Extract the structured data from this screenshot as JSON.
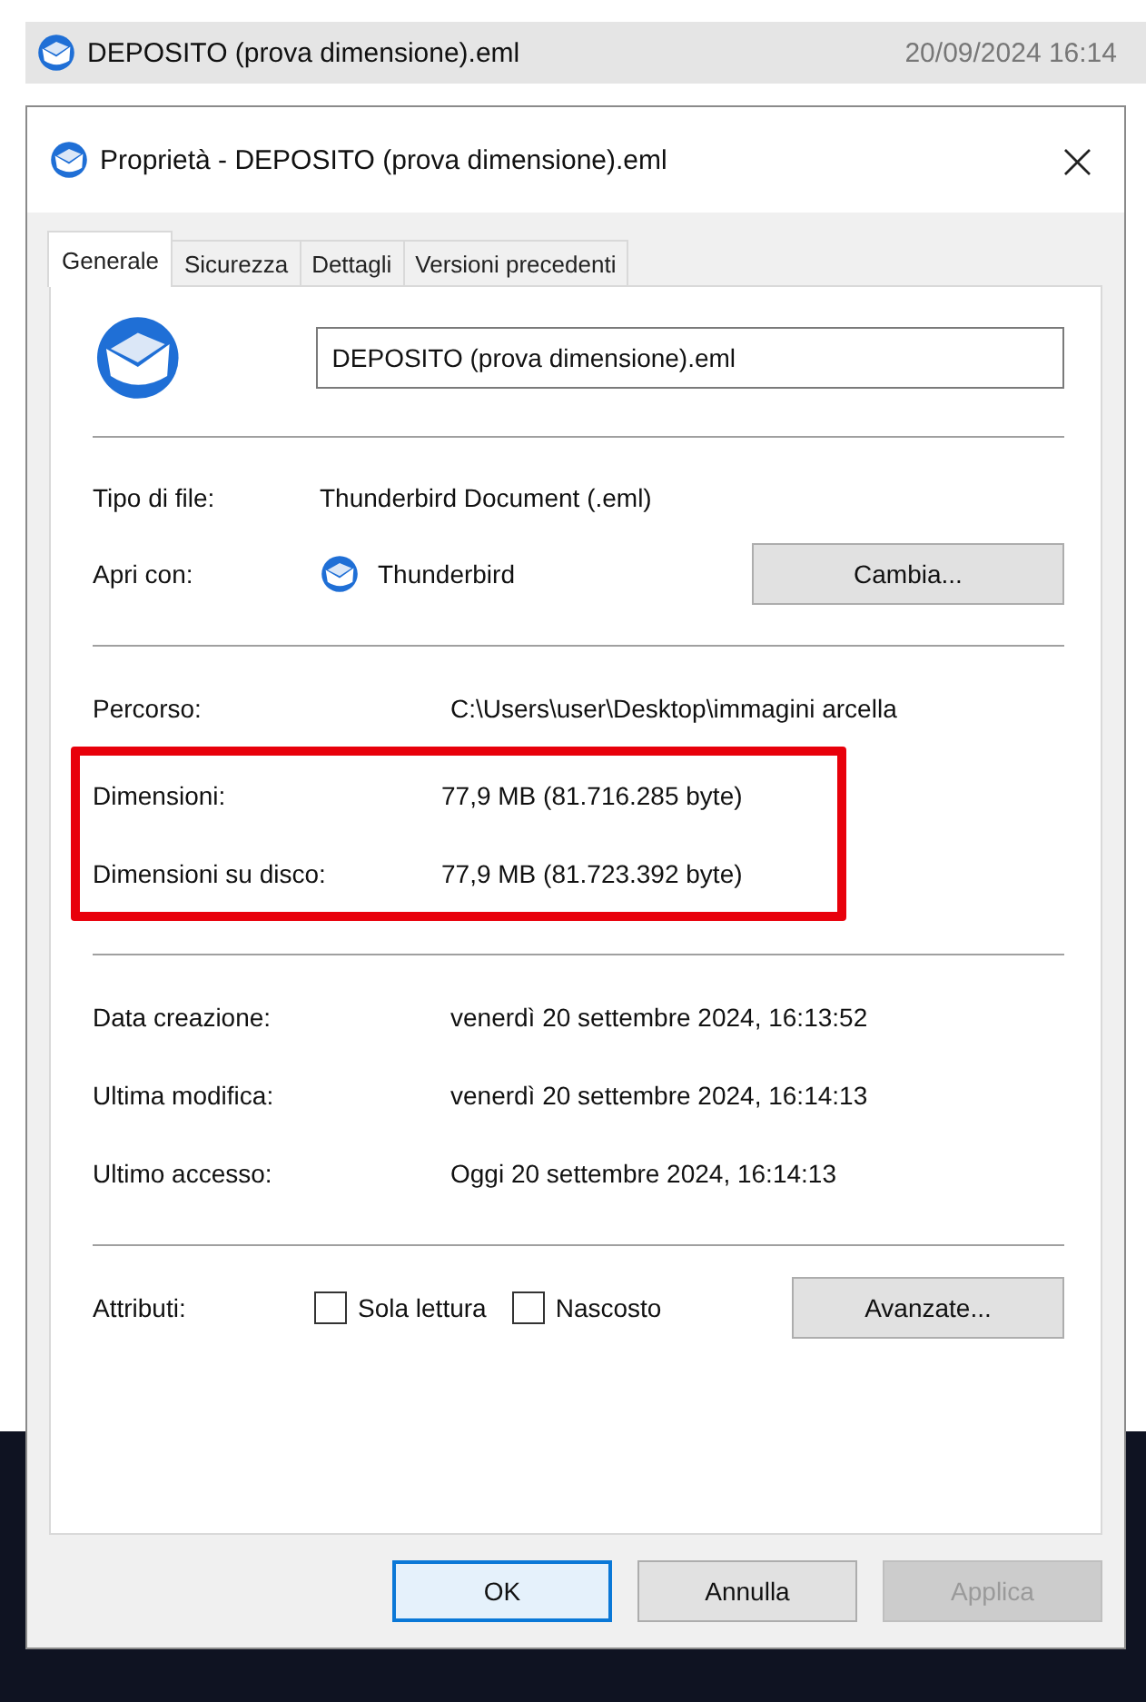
{
  "file_row": {
    "name": "DEPOSITO (prova dimensione).eml",
    "date": "20/09/2024 16:14"
  },
  "dialog": {
    "title": "Proprietà - DEPOSITO (prova dimensione).eml",
    "close": "×",
    "tabs": [
      {
        "label": "Generale",
        "selected": true
      },
      {
        "label": "Sicurezza",
        "selected": false
      },
      {
        "label": "Dettagli",
        "selected": false
      },
      {
        "label": "Versioni precedenti",
        "selected": false
      }
    ],
    "file_name": "DEPOSITO (prova dimensione).eml",
    "file_type": {
      "label": "Tipo di file:",
      "value": "Thunderbird Document (.eml)"
    },
    "open_with": {
      "label": "Apri con:",
      "app": "Thunderbird",
      "button": "Cambia..."
    },
    "location": {
      "label": "Percorso:",
      "value": "C:\\Users\\user\\Desktop\\immagini arcella"
    },
    "sizes": [
      {
        "label": "Dimensioni:",
        "value": "77,9 MB (81.716.285 byte)"
      },
      {
        "label": "Dimensioni su disco:",
        "value": "77,9 MB (81.723.392 byte)"
      }
    ],
    "dates": [
      {
        "label": "Data creazione:",
        "value": "venerdì 20 settembre 2024, 16:13:52"
      },
      {
        "label": "Ultima modifica:",
        "value": "venerdì 20 settembre 2024, 16:14:13"
      },
      {
        "label": "Ultimo accesso:",
        "value": "Oggi 20 settembre 2024, 16:14:13"
      }
    ],
    "attributes": {
      "label": "Attributi:",
      "options": [
        {
          "label": "Sola lettura",
          "checked": false
        },
        {
          "label": "Nascosto",
          "checked": false
        }
      ],
      "button": "Avanzate..."
    },
    "buttons": [
      {
        "label": "OK",
        "kind": "default",
        "disabled": false
      },
      {
        "label": "Annulla",
        "kind": "normal",
        "disabled": false
      },
      {
        "label": "Applica",
        "kind": "normal",
        "disabled": true
      }
    ]
  }
}
